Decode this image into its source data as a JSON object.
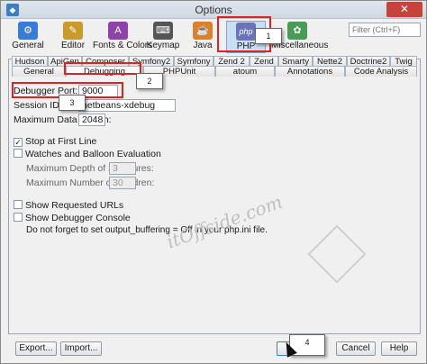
{
  "window": {
    "title": "Options",
    "close_label": "✕"
  },
  "search": {
    "placeholder": "Filter (Ctrl+F)"
  },
  "categories": [
    {
      "label": "General",
      "icon": "sliders-icon",
      "color": "#3a7bd5",
      "glyph": "⚙"
    },
    {
      "label": "Editor",
      "icon": "editor-icon",
      "color": "#c99a2e",
      "glyph": "✎"
    },
    {
      "label": "Fonts & Colors",
      "icon": "fonts-colors-icon",
      "color": "#8c44a8",
      "glyph": "A"
    },
    {
      "label": "Keymap",
      "icon": "keymap-icon",
      "color": "#555555",
      "glyph": "⌨"
    },
    {
      "label": "Java",
      "icon": "java-icon",
      "color": "#d9822b",
      "glyph": "☕"
    },
    {
      "label": "PHP",
      "icon": "php-icon",
      "color": "#6b74b8",
      "glyph": "php"
    },
    {
      "label": "Miscellaneous",
      "icon": "miscellaneous-icon",
      "color": "#4a9a58",
      "glyph": "✿"
    }
  ],
  "tabs_row1": [
    "Hudson",
    "ApiGen",
    "Composer",
    "Symfony2",
    "Symfony",
    "Zend 2",
    "Zend",
    "Smarty",
    "Nette2",
    "Doctrine2",
    "Twig"
  ],
  "tabs_row2": [
    "General",
    "Debugging",
    "PHPUnit",
    "atoum",
    "Annotations",
    "Code Analysis"
  ],
  "form": {
    "debugger_port_label": "Debugger Port:",
    "debugger_port_value": "9000",
    "session_id_label": "Session ID:",
    "session_id_value": "netbeans-xdebug",
    "max_data_length_label": "Maximum Data Length:",
    "max_data_length_value": "2048",
    "stop_first_line_label": "Stop at First Line",
    "stop_first_line_checked": true,
    "watches_label": "Watches and Balloon Evaluation",
    "watches_checked": false,
    "max_depth_label": "Maximum Depth of Structures:",
    "max_depth_value": "3",
    "max_children_label": "Maximum Number of Children:",
    "max_children_value": "30",
    "show_requested_urls_label": "Show Requested URLs",
    "show_debugger_console_label": "Show Debugger Console",
    "note": "Do not forget to set output_buffering = Off in your php.ini file."
  },
  "watermark": {
    "text": "itOffside.com"
  },
  "buttons": {
    "export": "Export...",
    "import": "Import...",
    "ok": "OK",
    "cancel": "Cancel",
    "help": "Help"
  },
  "callouts": [
    "1",
    "2",
    "3",
    "4"
  ],
  "colors": {
    "annotation_red": "#dd2222",
    "selected_category": "#c9dff5"
  }
}
